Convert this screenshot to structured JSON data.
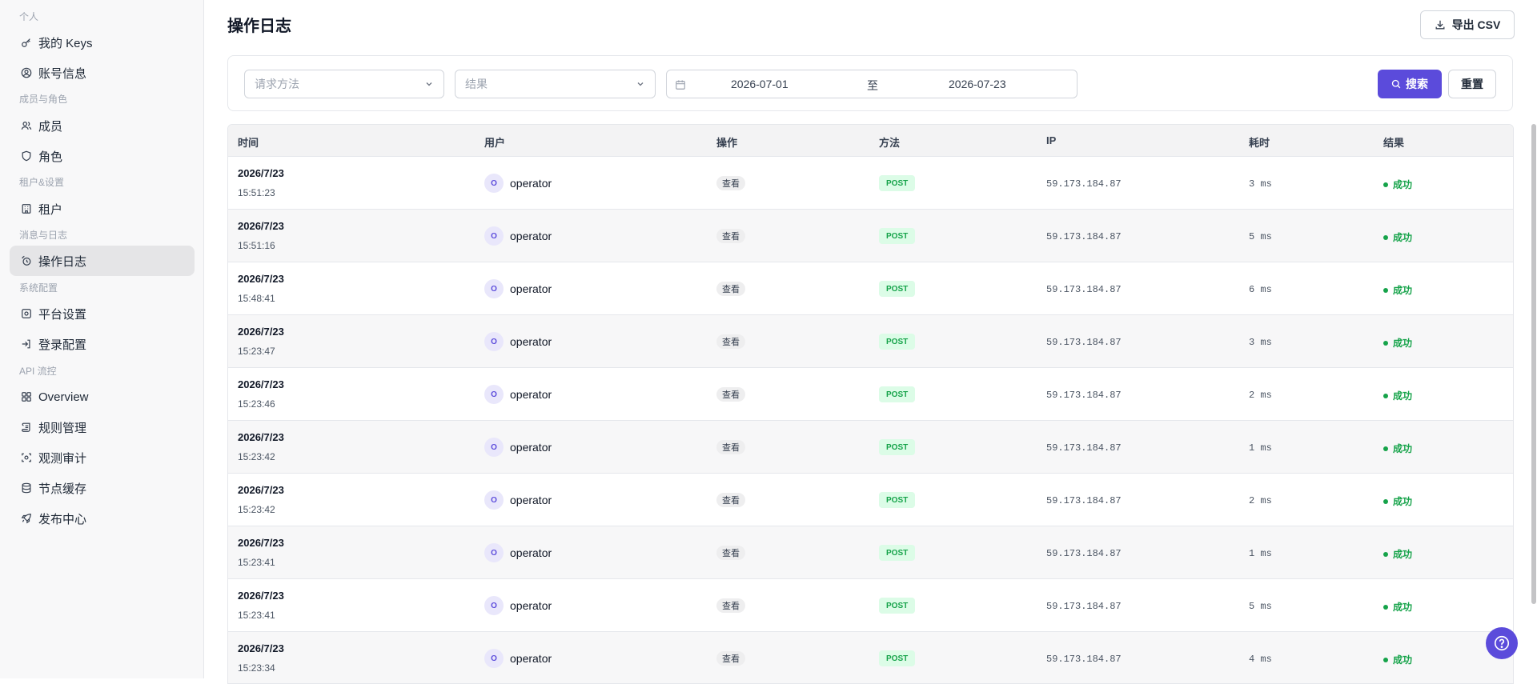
{
  "sidebar": {
    "groups": {
      "personal": "个人",
      "members_roles": "成员与角色",
      "tenant_settings": "租户&设置",
      "messages_logs": "消息与日志",
      "system_config": "系统配置",
      "api_flow": "API 流控"
    },
    "items": {
      "my_keys": {
        "label": "我的 Keys",
        "icon": "key-icon"
      },
      "account": {
        "label": "账号信息",
        "icon": "user-circle-icon"
      },
      "members": {
        "label": "成员",
        "icon": "users-icon"
      },
      "roles": {
        "label": "角色",
        "icon": "shield-icon"
      },
      "tenant": {
        "label": "租户",
        "icon": "building-icon"
      },
      "op_log": {
        "label": "操作日志",
        "icon": "log-icon",
        "active": true
      },
      "platform": {
        "label": "平台设置",
        "icon": "settings-icon"
      },
      "login_config": {
        "label": "登录配置",
        "icon": "login-icon"
      },
      "overview": {
        "label": "Overview",
        "icon": "grid-icon"
      },
      "rules": {
        "label": "规则管理",
        "icon": "scroll-icon"
      },
      "observe": {
        "label": "观测审计",
        "icon": "scan-icon"
      },
      "node_cache": {
        "label": "节点缓存",
        "icon": "database-icon"
      },
      "publish": {
        "label": "发布中心",
        "icon": "rocket-icon"
      }
    }
  },
  "header": {
    "title": "操作日志",
    "export_label": "导出 CSV"
  },
  "filters": {
    "method_placeholder": "请求方法",
    "result_placeholder": "结果",
    "date_from": "2026-07-01",
    "date_sep": "至",
    "date_to": "2026-07-23",
    "search_label": "搜索",
    "reset_label": "重置"
  },
  "table": {
    "columns": [
      "时间",
      "用户",
      "操作",
      "方法",
      "IP",
      "耗时",
      "结果"
    ],
    "rows": [
      {
        "date": "2026/7/23",
        "time": "15:51:23",
        "avatar": "O",
        "user": "operator",
        "op": "查看",
        "method": "POST",
        "ip": "59.173.184.87",
        "duration": "3 ms",
        "result": "成功"
      },
      {
        "date": "2026/7/23",
        "time": "15:51:16",
        "avatar": "O",
        "user": "operator",
        "op": "查看",
        "method": "POST",
        "ip": "59.173.184.87",
        "duration": "5 ms",
        "result": "成功"
      },
      {
        "date": "2026/7/23",
        "time": "15:48:41",
        "avatar": "O",
        "user": "operator",
        "op": "查看",
        "method": "POST",
        "ip": "59.173.184.87",
        "duration": "6 ms",
        "result": "成功"
      },
      {
        "date": "2026/7/23",
        "time": "15:23:47",
        "avatar": "O",
        "user": "operator",
        "op": "查看",
        "method": "POST",
        "ip": "59.173.184.87",
        "duration": "3 ms",
        "result": "成功"
      },
      {
        "date": "2026/7/23",
        "time": "15:23:46",
        "avatar": "O",
        "user": "operator",
        "op": "查看",
        "method": "POST",
        "ip": "59.173.184.87",
        "duration": "2 ms",
        "result": "成功"
      },
      {
        "date": "2026/7/23",
        "time": "15:23:42",
        "avatar": "O",
        "user": "operator",
        "op": "查看",
        "method": "POST",
        "ip": "59.173.184.87",
        "duration": "1 ms",
        "result": "成功"
      },
      {
        "date": "2026/7/23",
        "time": "15:23:42",
        "avatar": "O",
        "user": "operator",
        "op": "查看",
        "method": "POST",
        "ip": "59.173.184.87",
        "duration": "2 ms",
        "result": "成功"
      },
      {
        "date": "2026/7/23",
        "time": "15:23:41",
        "avatar": "O",
        "user": "operator",
        "op": "查看",
        "method": "POST",
        "ip": "59.173.184.87",
        "duration": "1 ms",
        "result": "成功"
      },
      {
        "date": "2026/7/23",
        "time": "15:23:41",
        "avatar": "O",
        "user": "operator",
        "op": "查看",
        "method": "POST",
        "ip": "59.173.184.87",
        "duration": "5 ms",
        "result": "成功"
      },
      {
        "date": "2026/7/23",
        "time": "15:23:34",
        "avatar": "O",
        "user": "operator",
        "op": "查看",
        "method": "POST",
        "ip": "59.173.184.87",
        "duration": "4 ms",
        "result": "成功"
      }
    ]
  },
  "colors": {
    "accent": "#5b4bdb",
    "success": "#16a34a",
    "success_bg": "#dcfce7"
  },
  "help": {
    "icon": "help-icon"
  }
}
